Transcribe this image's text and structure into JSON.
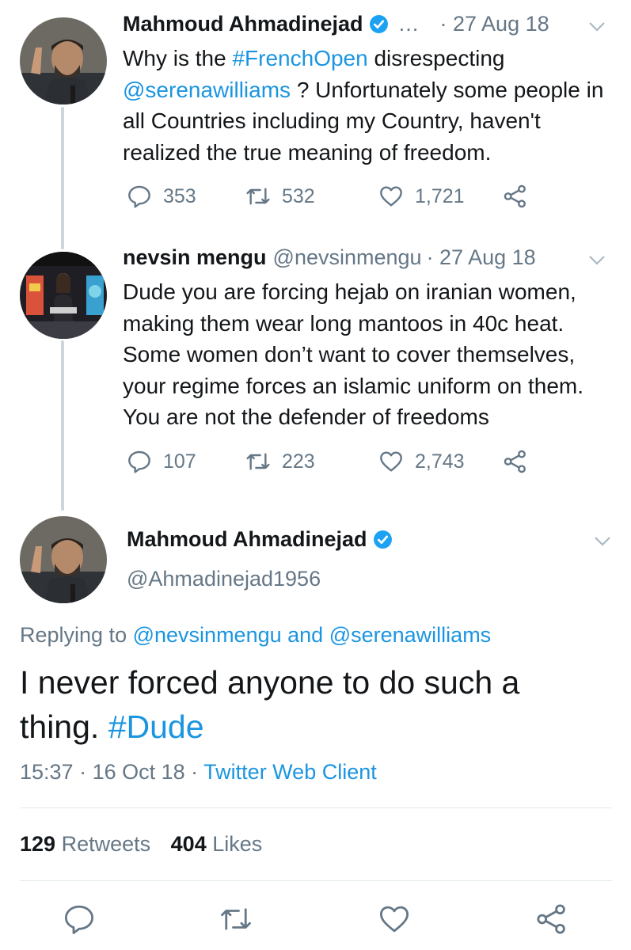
{
  "thread": [
    {
      "name": "Mahmoud Ahmadinejad",
      "truncation": "…",
      "date": "· 27 Aug 18",
      "text_parts": [
        {
          "text": "Why is the ",
          "link": false
        },
        {
          "text": "#FrenchOpen",
          "link": true
        },
        {
          "text": " disrespecting ",
          "link": false
        },
        {
          "text": "@serenawilliams",
          "link": true
        },
        {
          "text": " ? Unfortunately some people in all Countries including my Country, haven't realized the true meaning of freedom.",
          "link": false
        }
      ],
      "replies": "353",
      "retweets": "532",
      "likes": "1,721"
    },
    {
      "name": "nevsin mengu",
      "handle": "@nevsinmengu",
      "date": "· 27 Aug 18",
      "text": "Dude you are forcing hejab on iranian women, making them wear long mantoos in 40c heat. Some women don’t want to cover themselves, your regime forces an islamic uniform on them. You are not the defender of freedoms",
      "replies": "107",
      "retweets": "223",
      "likes": "2,743"
    }
  ],
  "main": {
    "name": "Mahmoud Ahmadinejad",
    "handle": "@Ahmadinejad1956",
    "replying_label": "Replying to",
    "replying_user1": "@nevsinmengu",
    "replying_and": "and",
    "replying_user2": "@serenawilliams",
    "text": "I never forced anyone to do such a thing.",
    "hashtag": "#Dude",
    "time": "15:37",
    "date": "16 Oct 18",
    "client": "Twitter Web Client",
    "retweets_count": "129",
    "retweets_label": "Retweets",
    "likes_count": "404",
    "likes_label": "Likes"
  },
  "icons": [
    "reply-icon",
    "retweet-icon",
    "like-icon",
    "share-icon",
    "verified-icon",
    "chevron-down-icon"
  ],
  "colors": {
    "link": "#1b95e0",
    "muted": "#657786",
    "text": "#14171a",
    "thread_line": "#ccd6dd"
  }
}
